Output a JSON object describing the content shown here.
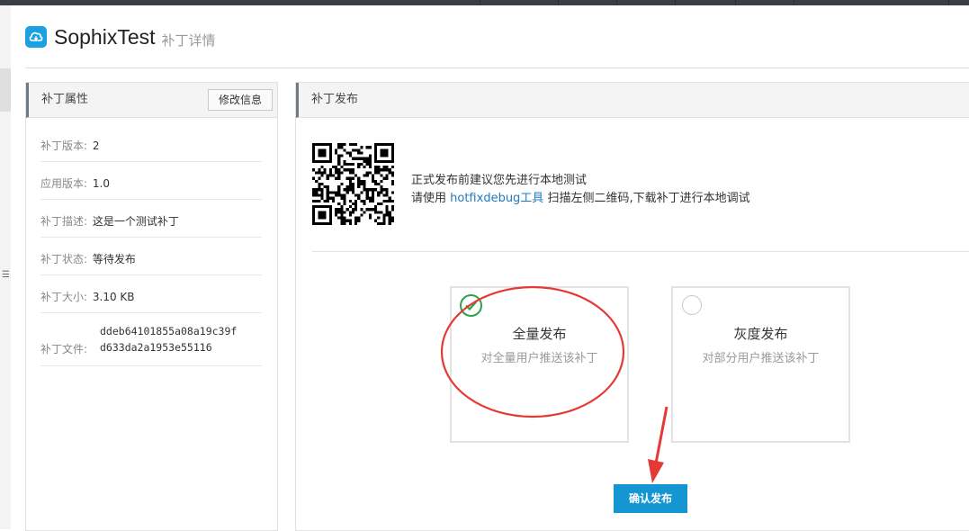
{
  "app": {
    "title": "SophixTest",
    "subtitle": "补丁详情",
    "logo_icon": "cloud-icon",
    "accent": "#1ba1e2"
  },
  "attributes": {
    "title": "补丁属性",
    "edit_label": "修改信息",
    "rows": [
      {
        "key": "补丁版本:",
        "value": "2"
      },
      {
        "key": "应用版本:",
        "value": "1.0"
      },
      {
        "key": "补丁描述:",
        "value": "这是一个测试补丁"
      },
      {
        "key": "补丁状态:",
        "value": "等待发布"
      },
      {
        "key": "补丁大小:",
        "value": "3.10 KB"
      },
      {
        "key": "补丁文件:",
        "value": "ddeb64101855a08a19c39f",
        "value2": "d633da2a1953e55116"
      }
    ]
  },
  "publish": {
    "title": "补丁发布",
    "tip_line1": "正式发布前建议您先进行本地测试",
    "tip_line2_prefix": "请使用 ",
    "tip_line2_link": "hotfixdebug工具",
    "tip_line2_suffix": " 扫描左侧二维码,下载补丁进行本地调试",
    "options": [
      {
        "title": "全量发布",
        "desc": "对全量用户推送该补丁",
        "selected": true
      },
      {
        "title": "灰度发布",
        "desc": "对部分用户推送该补丁",
        "selected": false
      }
    ],
    "confirm_label": "确认发布",
    "confirm_color": "#1596d2",
    "annotation_color": "#e53935"
  }
}
